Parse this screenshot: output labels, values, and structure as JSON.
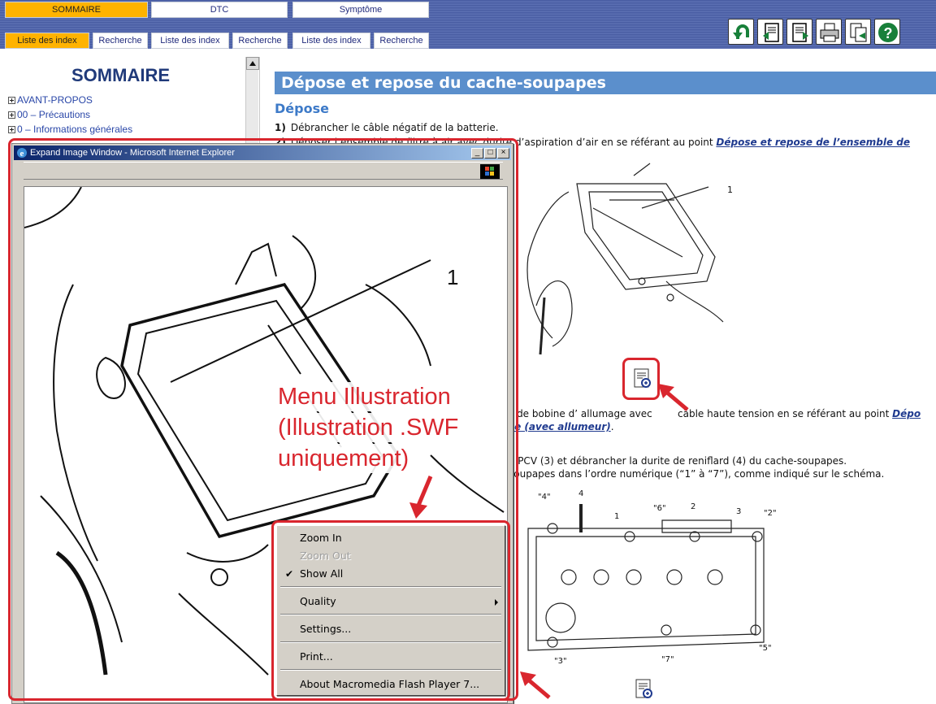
{
  "header": {
    "main_tabs": [
      {
        "label": "SOMMAIRE",
        "active": true
      },
      {
        "label": "DTC",
        "active": false
      },
      {
        "label": "Symptôme",
        "active": false
      }
    ],
    "sub_tabs": [
      {
        "label": "Liste des index",
        "active": true
      },
      {
        "label": "Recherche",
        "active": false
      },
      {
        "label": "Liste des index",
        "active": false
      },
      {
        "label": "Recherche",
        "active": false
      },
      {
        "label": "Liste des index",
        "active": false
      },
      {
        "label": "Recherche",
        "active": false
      }
    ],
    "toolbar_icons": [
      "back-icon",
      "previous-page-icon",
      "next-page-icon",
      "print-icon",
      "copy-icon",
      "help-icon"
    ],
    "accent": "#ffb300"
  },
  "sidebar": {
    "title": "SOMMAIRE",
    "items": [
      {
        "label": "AVANT-PROPOS"
      },
      {
        "label": "00 – Précautions"
      },
      {
        "label": "0 – Informations générales"
      }
    ]
  },
  "content": {
    "title": "Dépose et repose du cache-soupapes",
    "section": "Dépose",
    "steps": [
      {
        "num": "1)",
        "text": "Débrancher le câble négatif de la batterie."
      },
      {
        "num": "2)",
        "text": "Déposer l’ensemble de filtre à air avec durite d’aspiration d’air en se référant au point ",
        "link": "Dépose et repose de l’ensemble de"
      },
      {
        "text_a": "s de bobine d’ allumage avec",
        "text_b": "câble haute tension en se référant au point ",
        "link_a": "Dépo",
        "link_b": "ce (avec allumeur)",
        "text_c": "."
      },
      {
        "text": "e PCV (3) et débrancher la durite de reniflard (4) du cache-soupapes."
      },
      {
        "text": "soupapes dans l’ordre numérique (“1” à “7”), comme indiqué sur le schéma."
      }
    ],
    "diagram_labels": {
      "top": "1",
      "callouts": [
        "\"4\"",
        "4",
        "1",
        "\"6\"",
        "2",
        "3",
        "\"2\"",
        "\"3\"",
        "\"7\"",
        "\"5\""
      ]
    }
  },
  "popup": {
    "title": "Expand Image Window - Microsoft Internet Explorer",
    "image_label": "1",
    "window_buttons": [
      "_",
      "□",
      "×"
    ]
  },
  "context_menu": {
    "items": [
      {
        "label": "Zoom In",
        "disabled": false,
        "checked": false
      },
      {
        "label": "Zoom Out",
        "disabled": true,
        "checked": false
      },
      {
        "label": "Show All",
        "disabled": false,
        "checked": true
      },
      {
        "label": "Quality",
        "disabled": false,
        "submenu": true
      },
      {
        "label": "Settings...",
        "disabled": false
      },
      {
        "label": "Print...",
        "disabled": false
      },
      {
        "label": "About Macromedia Flash Player 7...",
        "disabled": false
      }
    ],
    "check_glyph": "✔"
  },
  "annotation": {
    "lines": [
      "Menu Illustration",
      "(Illustration .SWF",
      "uniquement)"
    ],
    "color": "#d9262e"
  }
}
